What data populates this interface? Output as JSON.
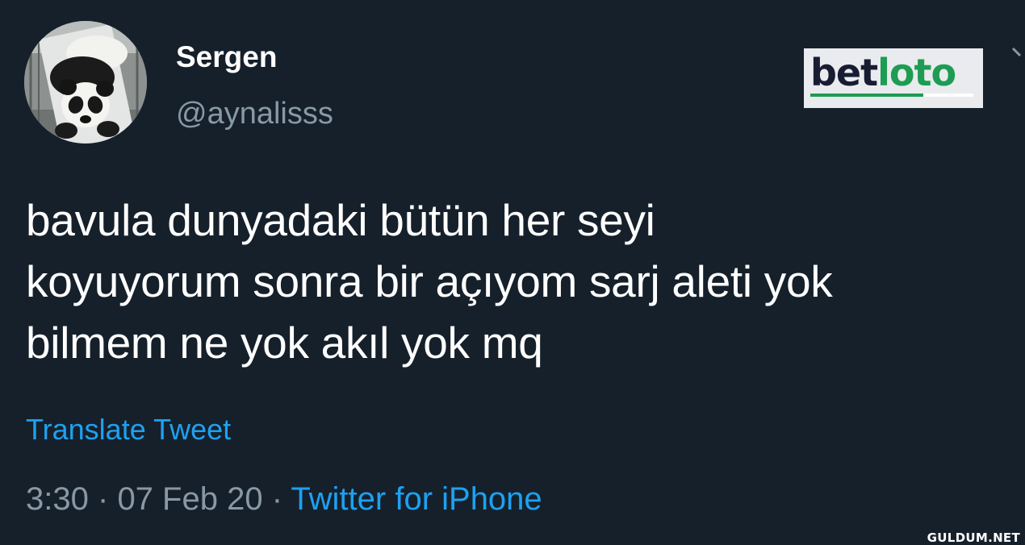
{
  "author": {
    "display_name": "Sergen",
    "handle": "@aynalisss",
    "avatar_icon": "panda-avatar"
  },
  "brand_logo": {
    "text_part1": "bet",
    "text_part2": "loto",
    "color1": "#171c33",
    "color2": "#1d9c52"
  },
  "tweet": {
    "lines": [
      "bavula dunyadaki bütün her seyi",
      "koyuyorum sonra bir açıyom sarj aleti yok",
      "bilmem ne yok akıl yok mq"
    ],
    "translate_label": "Translate Tweet",
    "time": "3:30",
    "date": "07 Feb 20",
    "separator": "·",
    "source": "Twitter for iPhone"
  },
  "watermark": "GULDUM.NET",
  "colors": {
    "background": "#16202b",
    "text": "#ffffff",
    "secondary": "#8899a6",
    "link": "#1da1f2"
  }
}
